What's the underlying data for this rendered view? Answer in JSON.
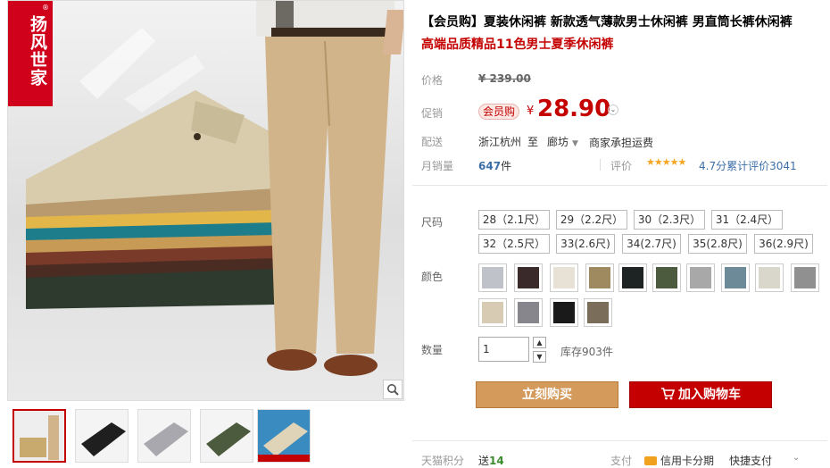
{
  "brand": {
    "logo_text": "扬风世家",
    "reg_mark": "®"
  },
  "product": {
    "title": "【会员购】夏装休闲裤 新款透气薄款男士休闲裤 男直筒长裤休闲裤",
    "subtitle": "高端品质精品11色男士夏季休闲裤"
  },
  "meta": {
    "price_label": "价格",
    "original_price": "¥ 239.00",
    "promo_label": "促销",
    "member_tag": "会员购",
    "yen": "¥",
    "promo_price": "28.90",
    "shipping_label": "配送",
    "ship_from": "浙江杭州",
    "ship_to_word": "至",
    "ship_to": "廊坊",
    "shipping_fee": "商家承担运费",
    "monthly_sales_label": "月销量",
    "monthly_sales_value": "647",
    "monthly_sales_unit": "件",
    "rating_label": "评价",
    "rating_stars": "★★★★★",
    "rating_text": "4.7分累计评价3041"
  },
  "sizes": {
    "label": "尺码",
    "options": [
      "28（2.1尺）",
      "29（2.2尺）",
      "30（2.3尺）",
      "31（2.4尺）",
      "32（2.5尺）",
      "33(2.6尺)",
      "34(2.7尺)",
      "35(2.8尺)",
      "36(2.9尺)"
    ]
  },
  "colors": {
    "label": "颜色",
    "swatches": [
      "#bfc2c8",
      "#3b2a2a",
      "#e8e2d6",
      "#9e8a5e",
      "#1e2424",
      "#4c5a3e",
      "#a8a8a8",
      "#6c8a98",
      "#d9d6cc",
      "#909090",
      "#d7ccb3",
      "#87868c",
      "#1a1a1a",
      "#7a6e5a"
    ]
  },
  "quantity": {
    "label": "数量",
    "value": "1",
    "stock": "库存903件"
  },
  "actions": {
    "buy_now": "立刻购买",
    "add_to_cart": "加入购物车"
  },
  "footer": {
    "points_label": "天猫积分",
    "points_prefix": "送",
    "points_value": "14",
    "pay_label": "支付",
    "credit_card": "信用卡分期",
    "express_pay": "快捷支付"
  },
  "colors_theme": {
    "accent": "#c40000",
    "buy_button": "#d39a5b"
  },
  "icons": [
    "zoom-icon",
    "cart-icon",
    "chevron-down-icon"
  ]
}
